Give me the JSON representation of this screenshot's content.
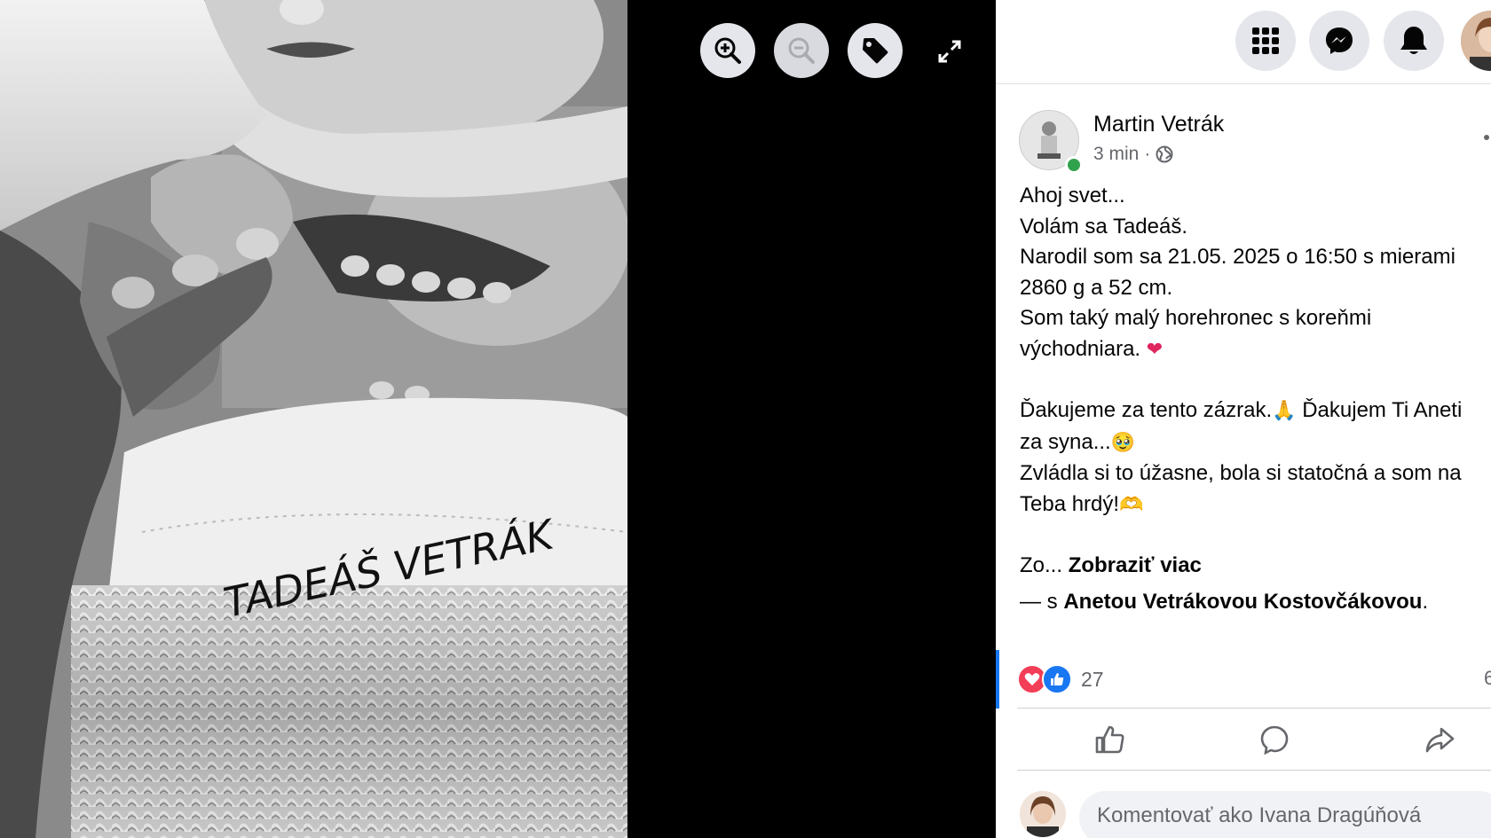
{
  "viewer": {
    "photo_caption_handwriting": "TADEÁŠ VETRÁK",
    "buttons": [
      {
        "name": "zoom-in-button",
        "icon": "zoom-in-icon",
        "enabled": true
      },
      {
        "name": "zoom-out-button",
        "icon": "zoom-out-icon",
        "enabled": false
      },
      {
        "name": "tag-button",
        "icon": "tag-icon",
        "enabled": true
      },
      {
        "name": "fullscreen-button",
        "icon": "expand-icon",
        "enabled": true
      }
    ]
  },
  "topbar": {
    "icons": [
      "menu-grid-icon",
      "messenger-icon",
      "bell-icon",
      "profile-avatar"
    ]
  },
  "post": {
    "author": "Martin Vetrák",
    "time": "3 min",
    "separator": "·",
    "privacy_icon": "globe-icon",
    "lines": [
      "Ahoj svet...",
      "Volám sa Tadeáš.",
      "Narodil som sa 21.05. 2025 o 16:50 s mierami",
      "2860 g a 52 cm.",
      "Som taký malý horehronec s koreňmi",
      "východniara. ",
      "Ďakujeme za tento zázrak.",
      " Ďakujem Ti Aneti",
      "za syna...",
      "Zvládla si to úžasne, bola si statočná a som na",
      "Teba hrdý!"
    ],
    "emojis": {
      "heart": "❤",
      "pray": "🙏",
      "tear": "🥹",
      "hands": "🫶"
    },
    "truncated_prefix": "Zo...",
    "see_more": "Zobraziť viac",
    "with_prefix": "— s",
    "tagged_person": "Anetou Vetrákovou Kostovčákovou",
    "with_suffix": ".",
    "reaction_count": "27",
    "share_count_partial": "6"
  },
  "actions": {
    "icons": [
      "like-icon",
      "comment-icon",
      "share-icon"
    ]
  },
  "comment": {
    "placeholder": "Komentovať ako Ivana Dragúňová"
  },
  "colors": {
    "accent": "#1877f2",
    "love": "#f33e58",
    "online": "#31a24c",
    "muted": "#65676b",
    "button_bg": "#e4e6eb"
  }
}
